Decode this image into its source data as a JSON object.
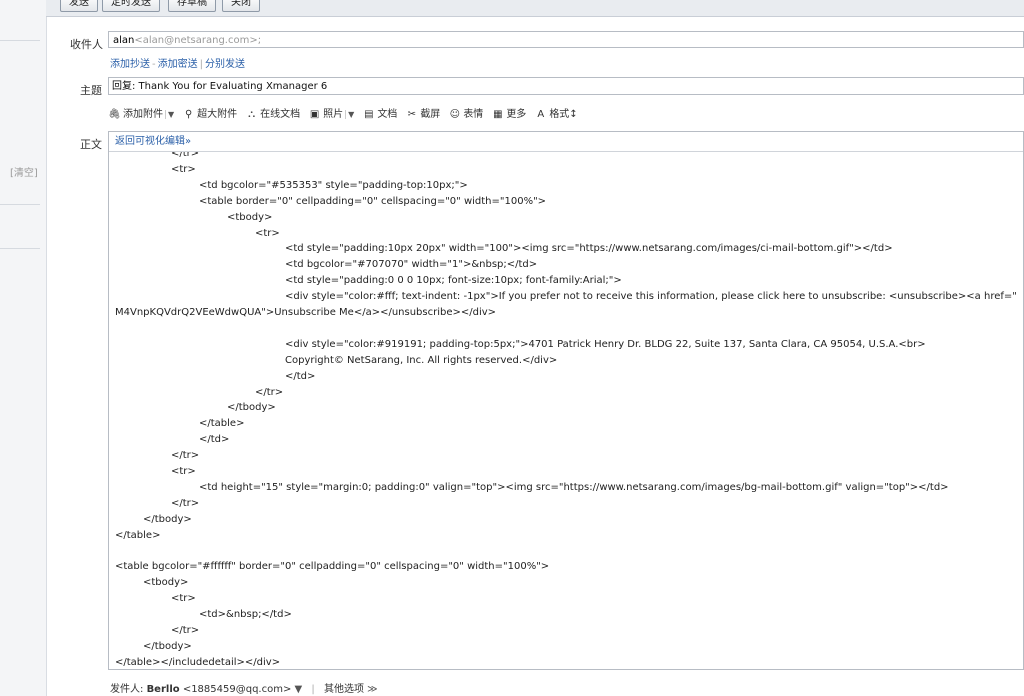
{
  "toolbar_top": {
    "send": "发送",
    "schedule": "定时发送",
    "draft": "存草稿",
    "close": "关闭"
  },
  "sidebar": {
    "clear": "[清空]"
  },
  "form": {
    "to_label": "收件人",
    "to_name": "alan",
    "to_address": "<alan@netsarang.com>;",
    "add_cc": "添加抄送",
    "add_bcc": "添加密送",
    "separate": "分别发送",
    "subject_label": "主题",
    "subject_value": "回复: Thank You for Evaluating Xmanager 6",
    "body_label": "正文"
  },
  "editor_tools": [
    {
      "icon": "paperclip-icon",
      "glyph": "🖇",
      "label": "添加附件",
      "dropdown": true
    },
    {
      "icon": "large-attachment-icon",
      "glyph": "⚲",
      "label": "超大附件",
      "dropdown": false
    },
    {
      "icon": "online-doc-icon",
      "glyph": "⛬",
      "label": "在线文档",
      "dropdown": false
    },
    {
      "icon": "photo-icon",
      "glyph": "▣",
      "label": "照片",
      "dropdown": true
    },
    {
      "icon": "document-icon",
      "glyph": "▤",
      "label": "文档",
      "dropdown": false
    },
    {
      "icon": "screenshot-icon",
      "glyph": "✂",
      "label": "截屏",
      "dropdown": false
    },
    {
      "icon": "emoji-icon",
      "glyph": "☺",
      "label": "表情",
      "dropdown": false
    },
    {
      "icon": "more-icon",
      "glyph": "▦",
      "label": "更多",
      "dropdown": false
    },
    {
      "icon": "format-icon",
      "glyph": "A",
      "label": "格式↕",
      "dropdown": false
    }
  ],
  "editor": {
    "back_to_visual": "返回可视化编辑»",
    "lines": [
      {
        "indent": 2,
        "text": "</tr>"
      },
      {
        "indent": 2,
        "text": "<tr>"
      },
      {
        "indent": 3,
        "text": "<td bgcolor=\"#535353\" style=\"padding-top:10px;\">"
      },
      {
        "indent": 3,
        "text": "<table border=\"0\" cellpadding=\"0\" cellspacing=\"0\" width=\"100%\">"
      },
      {
        "indent": 4,
        "text": "<tbody>"
      },
      {
        "indent": 5,
        "text": "<tr>"
      },
      {
        "indent": 6,
        "text": "<td style=\"padding:10px 20px\" width=\"100\"><img src=\"https://www.netsarang.com/images/ci-mail-bottom.gif\"></td>"
      },
      {
        "indent": 6,
        "text": "<td bgcolor=\"#707070\" width=\"1\">&nbsp;</td>"
      },
      {
        "indent": 6,
        "text": "<td style=\"padding:0 0 0 10px; font-size:10px; font-family:Arial;\">"
      },
      {
        "indent": 6,
        "text": "<div style=\"color:#fff; text-indent: -1px\">If you prefer not to receive this information, please click here to unsubscribe: <unsubscribe><a href=\""
      },
      {
        "indent": 0,
        "text": "M4VnpKQVdrQ2VEeWdwQUA\">Unsubscribe Me</a></unsubscribe></div>"
      },
      {
        "indent": 0,
        "text": ""
      },
      {
        "indent": 6,
        "text": "<div style=\"color:#919191; padding-top:5px;\">4701 Patrick Henry Dr. BLDG 22, Suite 137, Santa Clara, CA 95054, U.S.A.<br>"
      },
      {
        "indent": 6,
        "text": "Copyright© NetSarang, Inc. All rights reserved.</div>"
      },
      {
        "indent": 6,
        "text": "</td>"
      },
      {
        "indent": 5,
        "text": "</tr>"
      },
      {
        "indent": 4,
        "text": "</tbody>"
      },
      {
        "indent": 3,
        "text": "</table>"
      },
      {
        "indent": 3,
        "text": "</td>"
      },
      {
        "indent": 2,
        "text": "</tr>"
      },
      {
        "indent": 2,
        "text": "<tr>"
      },
      {
        "indent": 3,
        "text": "<td height=\"15\" style=\"margin:0; padding:0\" valign=\"top\"><img src=\"https://www.netsarang.com/images/bg-mail-bottom.gif\" valign=\"top\"></td>"
      },
      {
        "indent": 2,
        "text": "</tr>"
      },
      {
        "indent": 1,
        "text": "</tbody>"
      },
      {
        "indent": 0,
        "text": "</table>"
      },
      {
        "indent": 0,
        "text": ""
      },
      {
        "indent": 0,
        "text": "<table bgcolor=\"#ffffff\" border=\"0\" cellpadding=\"0\" cellspacing=\"0\" width=\"100%\">"
      },
      {
        "indent": 1,
        "text": "<tbody>"
      },
      {
        "indent": 2,
        "text": "<tr>"
      },
      {
        "indent": 3,
        "text": "<td>&nbsp;</td>"
      },
      {
        "indent": 2,
        "text": "</tr>"
      },
      {
        "indent": 1,
        "text": "</tbody>"
      },
      {
        "indent": 0,
        "text": "</table></includedetail></div>"
      }
    ]
  },
  "footer": {
    "sender_label": "发件人:",
    "sender_name": "Berllo",
    "sender_address": "<1885459@qq.com>",
    "other_options": "其他选项"
  }
}
